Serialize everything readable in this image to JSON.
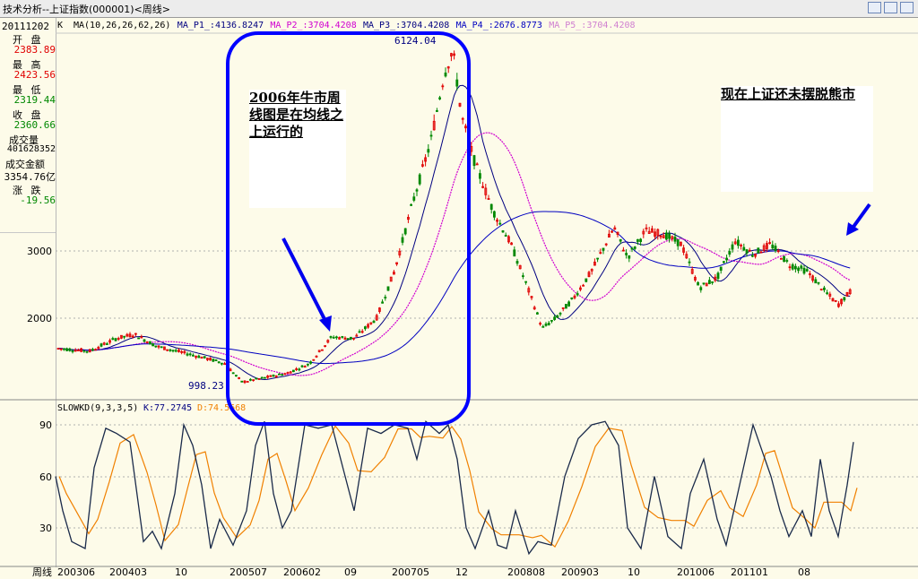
{
  "window": {
    "title": "技术分析--上证指数(000001)<周线>",
    "buttons": [
      "restore-icon",
      "prev-icon",
      "next-icon"
    ]
  },
  "sidebar": {
    "date": "20111202",
    "fields": [
      {
        "label": "开 盘",
        "value": "2383.89",
        "color": "#e00000"
      },
      {
        "label": "最 高",
        "value": "2423.56",
        "color": "#e00000"
      },
      {
        "label": "最 低",
        "value": "2319.44",
        "color": "#008800"
      },
      {
        "label": "收 盘",
        "value": "2360.66",
        "color": "#008800"
      },
      {
        "label": "成交量",
        "value": "401628352",
        "color": "#000000"
      },
      {
        "label": "成交金额",
        "value": "3354.76亿",
        "color": "#000000"
      },
      {
        "label": "涨 跌",
        "value": "-19.56",
        "color": "#008800"
      }
    ]
  },
  "main_panel": {
    "k_tag": "K",
    "indicator_header": [
      {
        "text": "MA(10,26,26,62,26)",
        "color": "#000000"
      },
      {
        "text": "MA_P1_:4136.8247",
        "color": "#000080"
      },
      {
        "text": "MA_P2_:3704.4208",
        "color": "#d000d0"
      },
      {
        "text": "MA_P3_:3704.4208",
        "color": "#000080"
      },
      {
        "text": "MA_P4_:2676.8773",
        "color": "#0000c0"
      },
      {
        "text": "MA_P5_:3704.4208",
        "color": "#d080d0"
      }
    ],
    "y_ticks": [
      "3000",
      "2000"
    ],
    "low_label": "998.23",
    "high_label": "6124.04"
  },
  "kd_panel": {
    "header_name": "SLOWKD(9,3,3,5)",
    "k_text": "K:77.2745",
    "d_text": "D:74.5668",
    "y_ticks": [
      "90",
      "60",
      "30"
    ]
  },
  "x_axis": {
    "period_label": "周线",
    "labels": [
      "200306",
      "200403",
      "10",
      "200507",
      "200602",
      "09",
      "200705",
      "12",
      "200808",
      "200903",
      "10",
      "201006",
      "201101",
      "08"
    ]
  },
  "annotations": [
    {
      "text": "2006年牛市周线图是在均线之上运行的"
    },
    {
      "text": "现在上证还未摆脱熊市"
    }
  ],
  "colors": {
    "up": "#e00000",
    "down": "#008800",
    "ma_p1": "#000080",
    "ma_p2": "#d000d0",
    "ma_p4": "#0000c0",
    "kd_k": "#1a2a4a",
    "kd_d": "#f08000",
    "highlight": "#0000ff",
    "background": "#fdfbe9"
  },
  "chart_data": {
    "type": "candlestick",
    "price_weekly_close_approx": [
      [
        "2003-06",
        1500
      ],
      [
        "2003-09",
        1420
      ],
      [
        "2004-01",
        1600
      ],
      [
        "2004-03",
        1750
      ],
      [
        "2004-06",
        1480
      ],
      [
        "2004-10",
        1390
      ],
      [
        "2005-01",
        1270
      ],
      [
        "2005-04",
        1180
      ],
      [
        "2005-07",
        1020
      ],
      [
        "2005-10",
        1120
      ],
      [
        "2006-01",
        1200
      ],
      [
        "2006-04",
        1450
      ],
      [
        "2006-07",
        1640
      ],
      [
        "2006-10",
        1820
      ],
      [
        "2007-01",
        2700
      ],
      [
        "2007-04",
        3500
      ],
      [
        "2007-07",
        4300
      ],
      [
        "2007-10",
        5900
      ],
      [
        "2008-01",
        5000
      ],
      [
        "2008-04",
        3500
      ],
      [
        "2008-07",
        2800
      ],
      [
        "2008-10",
        1800
      ],
      [
        "2009-01",
        2000
      ],
      [
        "2009-04",
        2500
      ],
      [
        "2009-07",
        3400
      ],
      [
        "2009-10",
        3100
      ],
      [
        "2010-01",
        3200
      ],
      [
        "2010-04",
        3000
      ],
      [
        "2010-07",
        2500
      ],
      [
        "2010-10",
        2950
      ],
      [
        "2011-01",
        2800
      ],
      [
        "2011-04",
        3000
      ],
      [
        "2011-07",
        2800
      ],
      [
        "2011-10",
        2400
      ],
      [
        "2011-12",
        2360
      ]
    ],
    "kd": {
      "k_current": 77.2745,
      "d_current": 74.5668,
      "ylim": [
        0,
        100
      ]
    },
    "ylim_price": [
      1000,
      6200
    ]
  }
}
